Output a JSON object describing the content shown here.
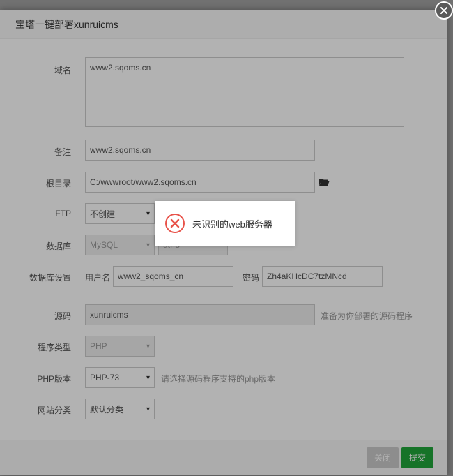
{
  "dialog": {
    "title": "宝塔一键部署xunruicms",
    "close_icon": "close-icon"
  },
  "form": {
    "domain": {
      "label": "域名",
      "value": "www2.sqoms.cn"
    },
    "remark": {
      "label": "备注",
      "value": "www2.sqoms.cn"
    },
    "root": {
      "label": "根目录",
      "value": "C:/wwwroot/www2.sqoms.cn",
      "icon": "folder-open-icon"
    },
    "ftp": {
      "label": "FTP",
      "selected": "不创建"
    },
    "database": {
      "label": "数据库",
      "selected": "MySQL",
      "charset": "utf-8"
    },
    "db_settings": {
      "label": "数据库设置",
      "user_label": "用户名",
      "user_value": "www2_sqoms_cn",
      "pass_label": "密码",
      "pass_value": "Zh4aKHcDC7tzMNcd"
    },
    "source": {
      "label": "源码",
      "value": "xunruicms",
      "hint": "准备为你部署的源码程序"
    },
    "program_type": {
      "label": "程序类型",
      "selected": "PHP"
    },
    "php_version": {
      "label": "PHP版本",
      "selected": "PHP-73",
      "hint": "请选择源码程序支持的php版本"
    },
    "site_category": {
      "label": "网站分类",
      "selected": "默认分类"
    }
  },
  "footer": {
    "close_label": "关闭",
    "submit_label": "提交"
  },
  "toast": {
    "message": "未识别的web服务器",
    "icon": "error-circle-icon",
    "icon_color": "#e8534a"
  },
  "colors": {
    "accent_green": "#20a53a",
    "close_button": "#5a5a5a"
  }
}
